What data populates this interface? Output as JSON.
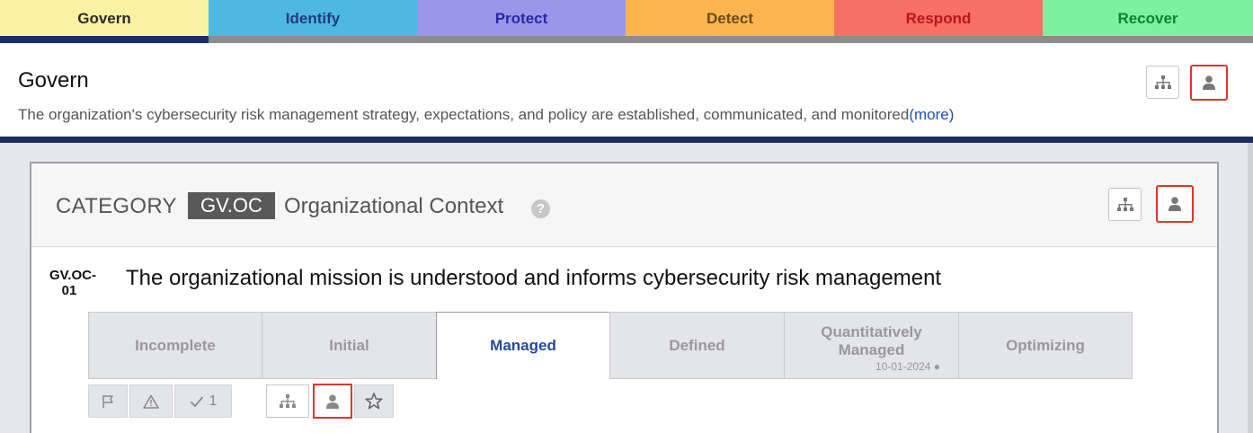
{
  "function_tabs": [
    {
      "label": "Govern",
      "bg": "#faf2a3",
      "color": "#2a2a2a",
      "active": true
    },
    {
      "label": "Identify",
      "bg": "#4fb8e0",
      "color": "#1d3a85",
      "active": false
    },
    {
      "label": "Protect",
      "bg": "#9a96ea",
      "color": "#2b28a8",
      "active": false
    },
    {
      "label": "Detect",
      "bg": "#fbb54e",
      "color": "#6b4a1a",
      "active": false
    },
    {
      "label": "Respond",
      "bg": "#f86f66",
      "color": "#b8161b",
      "active": false
    },
    {
      "label": "Recover",
      "bg": "#7cf2a0",
      "color": "#13802e",
      "active": false
    }
  ],
  "function_header": {
    "title": "Govern",
    "description": "The organization's cybersecurity risk management strategy, expectations, and policy are established, communicated, and monitored",
    "more_link": "(more)"
  },
  "category": {
    "label": "CATEGORY",
    "code": "GV.OC",
    "name": "Organizational Context",
    "help_glyph": "?"
  },
  "subcategory": {
    "id": "GV.OC-01",
    "title": "The organizational mission is understood and informs cybersecurity risk management"
  },
  "maturity_levels": [
    {
      "label": "Incomplete",
      "active": false
    },
    {
      "label": "Initial",
      "active": false
    },
    {
      "label": "Managed",
      "active": true
    },
    {
      "label": "Defined",
      "active": false
    },
    {
      "label": "Quantitatively Managed",
      "active": false,
      "date": "10-01-2024 ●"
    },
    {
      "label": "Optimizing",
      "active": false
    }
  ],
  "actions": {
    "flag_icon": "flag-icon",
    "warning_icon": "warning-icon",
    "check_count": "1",
    "org_chart_icon": "org-chart-icon",
    "person_icon": "person-icon",
    "star_icon": "star-icon"
  },
  "colors": {
    "accent_navy": "#1b2b63",
    "selected_outline": "#e0342b",
    "link_blue": "#1f4fb8",
    "active_level_text": "#23499a"
  }
}
